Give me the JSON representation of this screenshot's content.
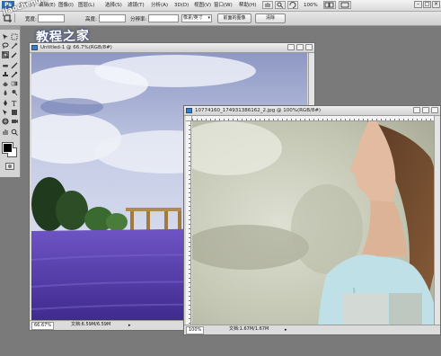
{
  "menubar": {
    "app_logo": "Ps",
    "items": [
      "文件(F)",
      "编辑(E)",
      "图像(I)",
      "图层(L)",
      "选择(S)",
      "滤镜(T)",
      "分析(A)",
      "3D(D)",
      "视图(V)",
      "窗口(W)",
      "帮助(H)"
    ],
    "zoom_value": "100%",
    "icons": [
      "hand-icon",
      "zoom-icon",
      "rotate-view-icon",
      "arrange-documents-icon",
      "screen-mode-icon"
    ]
  },
  "options_bar": {
    "width_label": "宽度:",
    "width_value": "",
    "height_label": "高度:",
    "height_value": "",
    "resolution_label": "分辨率:",
    "resolution_value": "",
    "unit_value": "像素/英寸",
    "front_image_button": "前面的图像",
    "clear_button": "清除"
  },
  "watermark": {
    "text": "教程之家",
    "url": "jiaocheng.com"
  },
  "documents": [
    {
      "title": "Untitled-1 @ 66.7%(RGB/8#)",
      "status_zoom": "66.67%",
      "status_info": "文档:6.59M/6.59M"
    },
    {
      "title": "10774160_174931386162_2.jpg @ 100%(RGB/8#)",
      "status_zoom": "100%",
      "status_info": "文档:1.67M/1.67M"
    }
  ],
  "colors": {
    "workspace": "#7a7a7a",
    "panel": "#d4d4d4",
    "accent": "#2a6cb0",
    "lavender": "#5b3fb0",
    "sky": "#c9d4ea"
  }
}
